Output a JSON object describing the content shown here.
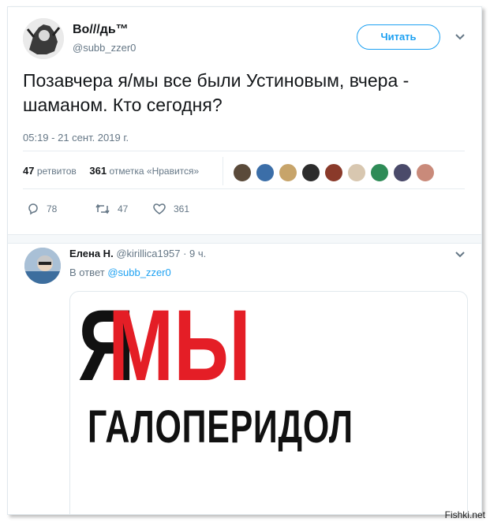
{
  "tweet": {
    "author_name": "Во///дь™",
    "author_handle": "@subb_zzer0",
    "follow_label": "Читать",
    "text": "Позавчера я/мы все были Устиновым, вчера - шаманом. Кто сегодня?",
    "timestamp": "05:19 - 21 сент. 2019 г.",
    "retweets_count": "47",
    "retweets_label": "ретвитов",
    "likes_count": "361",
    "likes_label": "отметка «Нравится»",
    "likers": [
      "#5a4a3a",
      "#3b6ea8",
      "#c7a46a",
      "#2c2c2c",
      "#8a3a2a",
      "#d8c7b0",
      "#2e8b57",
      "#4a4a6a",
      "#c98a7a"
    ],
    "actions": {
      "replies": "78",
      "retweets": "47",
      "likes": "361"
    }
  },
  "reply": {
    "name": "Елена Н.",
    "handle": "@kirillica1957",
    "time": "· 9 ч.",
    "in_reply_prefix": "В ответ",
    "in_reply_handle": "@subb_zzer0",
    "image_text": {
      "first_letter": "Я",
      "word": "МЫ",
      "bottom": "ГАЛОПЕРИДОЛ"
    }
  },
  "watermark": "Fishki.net",
  "colors": {
    "accent": "#1da1f2",
    "muted": "#657786",
    "red": "#e41e26"
  }
}
